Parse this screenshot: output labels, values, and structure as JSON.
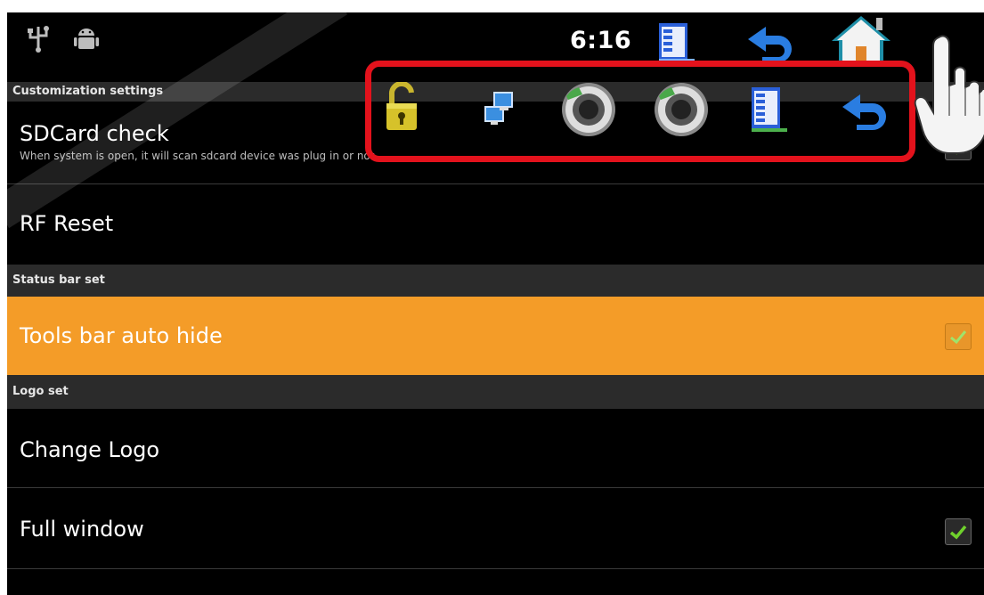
{
  "status_bar": {
    "time": "6:16",
    "icons": [
      "usb-icon",
      "android-icon",
      "menu-list-icon",
      "back-arrow-icon",
      "home-icon"
    ]
  },
  "sections": {
    "customization": "Customization settings",
    "status_bar_set": "Status bar set",
    "logo_set": "Logo set"
  },
  "items": {
    "sdcard": {
      "title": "SDCard check",
      "summary": "When system is open, it will scan sdcard device was plug in or not.",
      "checked": true
    },
    "rf_reset": {
      "title": "RF Reset"
    },
    "tools_bar": {
      "title": "Tools bar auto hide",
      "checked": true
    },
    "change_logo": {
      "title": "Change Logo"
    },
    "full_window": {
      "title": "Full window",
      "checked": true
    }
  },
  "toolbox": {
    "icons": [
      "unlock-icon",
      "network-icon",
      "volume-down-icon",
      "volume-up-icon",
      "menu-list-icon",
      "back-arrow-icon"
    ]
  },
  "colors": {
    "highlight": "#f49c28",
    "section_header": "#2b2b2b",
    "toolbox_border": "#e3121c",
    "check_green": "#6fd12c"
  }
}
